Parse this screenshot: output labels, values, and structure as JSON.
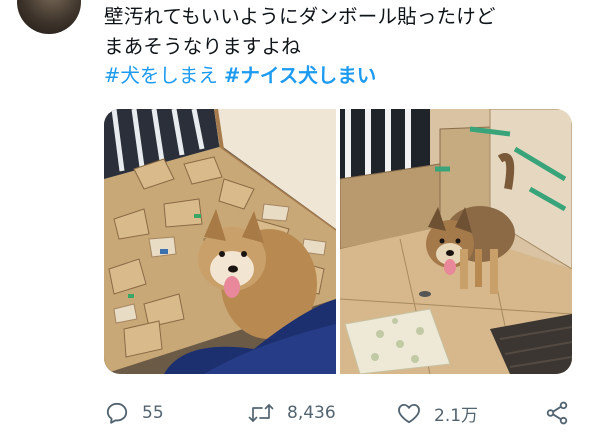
{
  "tweet": {
    "text": "壁汚れてもいいようにダンボール貼ったけど\nまあそうなりますよね",
    "hashtags": [
      {
        "label": "#犬をしまえ",
        "bold": false
      },
      {
        "label": "#ナイス犬しまい",
        "bold": true
      }
    ]
  },
  "media": {
    "photos": [
      {
        "subject": "dog-on-shredded-cardboard"
      },
      {
        "subject": "dog-in-cardboard-walled-room"
      }
    ]
  },
  "actions": {
    "reply": {
      "count": "55",
      "icon": "reply-icon"
    },
    "retweet": {
      "count": "8,436",
      "icon": "retweet-icon"
    },
    "like": {
      "count": "2.1万",
      "icon": "heart-icon"
    },
    "share": {
      "icon": "share-icon"
    }
  },
  "colors": {
    "hashtag": "#1d9bf0",
    "action_icon": "#536471",
    "text": "#0f1419"
  }
}
